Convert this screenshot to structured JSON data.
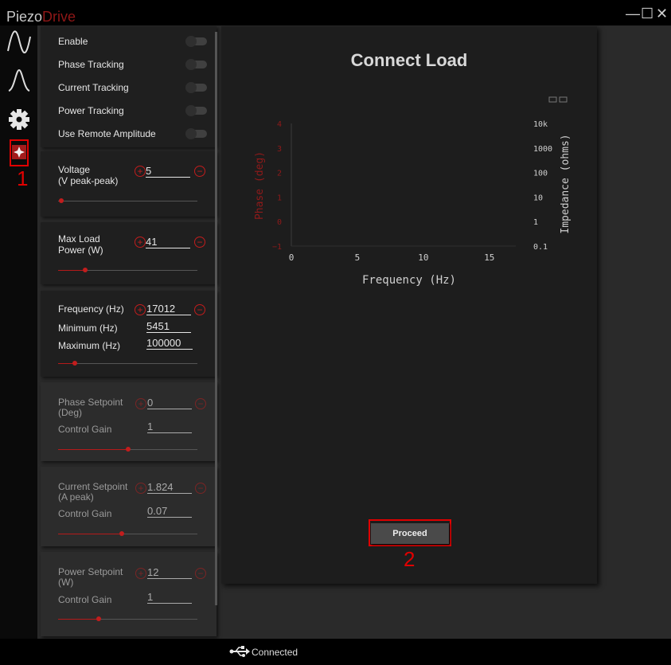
{
  "app": {
    "brand_part1": "Piezo",
    "brand_part2": "Drive"
  },
  "window_controls": {
    "minimize": "—",
    "maximize": "☐",
    "close": "✕"
  },
  "sidebar": {
    "icons": [
      "sine-wave-icon",
      "peak-icon",
      "gear-icon",
      "piezo-drive-icon"
    ],
    "annotation_1": "1"
  },
  "toggles": [
    {
      "label": "Enable",
      "on": false
    },
    {
      "label": "Phase Tracking",
      "on": false
    },
    {
      "label": "Current Tracking",
      "on": false
    },
    {
      "label": "Power Tracking",
      "on": false
    },
    {
      "label": "Use Remote Amplitude",
      "on": false
    }
  ],
  "voltage": {
    "label_line1": "Voltage",
    "label_line2": "(V peak-peak)",
    "value": "5",
    "slider": 0.0
  },
  "max_load": {
    "label_line1": "Max Load",
    "label_line2": "Power (W)",
    "value": "41",
    "slider": 0.2
  },
  "frequency": {
    "label": "Frequency (Hz)",
    "value": "17012",
    "min_label": "Minimum (Hz)",
    "min_value": "5451",
    "max_label": "Maximum (Hz)",
    "max_value": "100000",
    "slider": 0.12
  },
  "phase_setpoint": {
    "label_line1": "Phase Setpoint",
    "label_line2": "(Deg)",
    "value": "0",
    "gain_label": "Control Gain",
    "gain_value": "1",
    "slider": 0.5
  },
  "current_setpoint": {
    "label_line1": "Current Setpoint",
    "label_line2": "(A peak)",
    "value": "1.824",
    "gain_label": "Control Gain",
    "gain_value": "0.07",
    "slider": 0.46
  },
  "power_setpoint": {
    "label_line1": "Power Setpoint",
    "label_line2": "(W)",
    "value": "12",
    "gain_label": "Control Gain",
    "gain_value": "1",
    "slider": 0.29
  },
  "main": {
    "title": "Connect Load",
    "proceed_label": "Proceed",
    "annotation_2": "2"
  },
  "status": {
    "connection": "Connected"
  },
  "chart_data": {
    "type": "line",
    "title": "",
    "xlabel": "Frequency (Hz)",
    "ylabel_left": "Phase (deg)",
    "ylabel_right": "Impedance (ohms)",
    "xlim": [
      0,
      17
    ],
    "x_ticks": [
      "0",
      "5",
      "10",
      "15"
    ],
    "y_left_ticks": [
      "−1",
      "0",
      "1",
      "2",
      "3",
      "4"
    ],
    "y_right_ticks": [
      "0.1",
      "1",
      "10",
      "100",
      "1000",
      "10k"
    ],
    "series": [],
    "colors": {
      "left_axis": "#8f1a1a",
      "right_axis": "#d0d0d0"
    }
  }
}
